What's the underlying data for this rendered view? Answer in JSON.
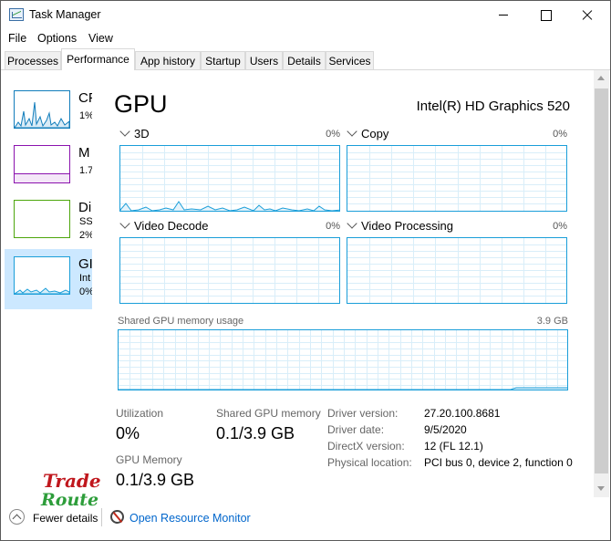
{
  "window": {
    "title": "Task Manager"
  },
  "menu": [
    "File",
    "Options",
    "View"
  ],
  "tabs": [
    {
      "label": "Processes",
      "active": false
    },
    {
      "label": "Performance",
      "active": true
    },
    {
      "label": "App history",
      "active": false
    },
    {
      "label": "Startup",
      "active": false
    },
    {
      "label": "Users",
      "active": false
    },
    {
      "label": "Details",
      "active": false
    },
    {
      "label": "Services",
      "active": false
    }
  ],
  "sidebar": {
    "items": [
      {
        "name": "CP",
        "detail": "1%",
        "color": "#117dbb",
        "selected": false
      },
      {
        "name": "M",
        "detail": "1.7",
        "color": "#8b12ae",
        "selected": false
      },
      {
        "name": "Di",
        "detail": "SS",
        "detail2": "2%",
        "color": "#4da60c",
        "selected": false
      },
      {
        "name": "GI",
        "detail": "Int",
        "detail2": "0%",
        "color": "#1a9ed9",
        "selected": true
      }
    ]
  },
  "gpu": {
    "title": "GPU",
    "model": "Intel(R) HD Graphics 520",
    "engines": [
      {
        "label": "3D",
        "percent": "0%"
      },
      {
        "label": "Copy",
        "percent": "0%"
      },
      {
        "label": "Video Decode",
        "percent": "0%"
      },
      {
        "label": "Video Processing",
        "percent": "0%"
      }
    ],
    "shared_memory_label": "Shared GPU memory usage",
    "shared_memory_max": "3.9 GB",
    "stats": {
      "utilization_label": "Utilization",
      "utilization_value": "0%",
      "shared_label": "Shared GPU memory",
      "shared_value": "0.1/3.9 GB",
      "gpu_memory_label": "GPU Memory",
      "gpu_memory_value": "0.1/3.9 GB"
    },
    "info": [
      {
        "label": "Driver version:",
        "value": "27.20.100.8681"
      },
      {
        "label": "Driver date:",
        "value": "9/5/2020"
      },
      {
        "label": "DirectX version:",
        "value": "12 (FL 12.1)"
      },
      {
        "label": "Physical location:",
        "value": "PCI bus 0, device 2, function 0"
      }
    ]
  },
  "footer": {
    "fewer_details": "Fewer details",
    "open_resource_monitor": "Open Resource Monitor"
  },
  "watermark": {
    "line1": "Trade",
    "line2": "Route"
  },
  "colors": {
    "accent": "#1a9ed9",
    "selected_bg": "#cce8ff",
    "link": "#0066cc"
  }
}
